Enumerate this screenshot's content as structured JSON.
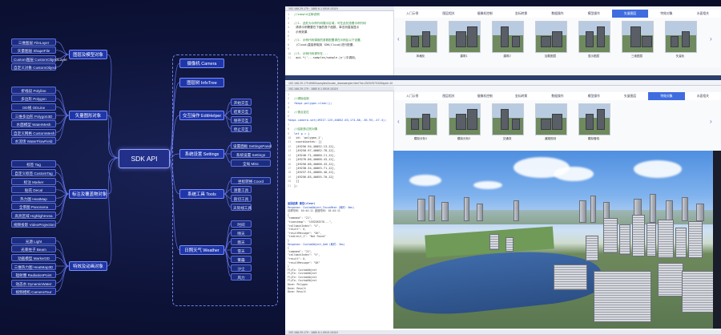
{
  "mindmap": {
    "root": "SDK API",
    "left_branches": [
      {
        "label": "图层及模型对象",
        "leaves": [
          "三维图层 FileLayer",
          "矢量图层 ShapeFile",
          "Custom图层 CustomObjectLayer",
          "自定义对象 CustomObject"
        ]
      },
      {
        "label": "矢量图形对象",
        "leaves": [
          "折线段 Polyline",
          "多边形 Polygon",
          "OD线 ODLine",
          "三维多边形 Polygon3D",
          "水面模型 WaterMesh",
          "自定义网格 CustomMesh",
          "水流场 WaterFlowField"
        ]
      },
      {
        "label": "标注及覆盖物对象",
        "leaves": [
          "标签 Tag",
          "自定义标签 CustomTag",
          "标注 Marker",
          "贴花 Decal",
          "热力图 HeatMap",
          "全景图 Panorama",
          "高亮区域 HighlightArea",
          "视频投影 VideoProjection"
        ]
      },
      {
        "label": "特效及动画对象",
        "leaves": [
          "光源 Light",
          "光束柱子 Beam",
          "动画模型 Marker3D",
          "三维热力图 HeatMap3D",
          "辐射圈 RadiationPoint",
          "动态水 DynamicWater",
          "视频相机 CameraTour"
        ]
      }
    ],
    "right_branches": [
      {
        "label": "摄像机 Camera",
        "leaves": []
      },
      {
        "label": "图层树 InfoTree",
        "leaves": []
      },
      {
        "label": "交互操作 EditHelper",
        "leaves": [
          "开始交互",
          "结束交互",
          "保存交互",
          "停止交互"
        ]
      },
      {
        "label": "系统设置 Settings",
        "leaves": [
          "设置面板 SettingsPanel",
          "系统设置 Settings",
          "全局 Misc"
        ]
      },
      {
        "label": "系统工具 Tools",
        "leaves": [
          "坐标转换 Coord",
          "测量工具",
          "剖切工具",
          "天际线工具"
        ]
      },
      {
        "label": "日照天气 Weather",
        "leaves": [
          "时间",
          "晴天",
          "雨天",
          "雪天",
          "雾霾",
          "沙尘",
          "风力"
        ]
      }
    ]
  },
  "screen": {
    "top_window_title": "192.168.29.179 : 1880    6.1.0919.10119",
    "mid_window_url": "192.168.29.179:8080/samples/locate_drawsample.html?id=25202570326&pid=10",
    "mid_window_title": "192.168.29.179 : 1880    6.1.0919.10119",
    "bottom_bar": "192.168.29.179 : 1880    6.1.0919.10119",
    "top_tabs": [
      "入门示例",
      "图层相关",
      "摄像机控制",
      "坐标转换",
      "数据操作",
      "模型操作",
      "矢量图层",
      "特效对象",
      "水面相关"
    ],
    "top_active_tab": 6,
    "top_thumbs": [
      "风格化",
      "建筑1",
      "建筑2",
      "加载图层",
      "显示图层",
      "三维图层",
      "矢量化"
    ],
    "mid_tabs": [
      "入门示例",
      "图层相关",
      "摄像机控制",
      "坐标转换",
      "数据操作",
      "模型操作",
      "矢量图层",
      "特效对象",
      "水面相关"
    ],
    "mid_active_tab": 7,
    "mid_thumbs": [
      "模拟分析1",
      "模拟分析2",
      "交通流",
      "道路规划",
      "模拟管线"
    ],
    "code_top": [
      "//sample注释说明",
      "",
      "//1. 此处为示例代码展示区域，可在此处查看示例代码",
      "     请求示例需要在下面的首个函数，单击则直接显示",
      "     示例效果",
      "",
      "//2. 示例代码调用的参数配置请在示例区以下设置，",
      "     (Cloud)直接获取到 SDK(Cloud)进行配置.",
      "",
      "//3. 示例代码请写在...",
      "    api.*('...samples/sample.js')中调用。"
    ],
    "code_mid": [
      "",
      "//清除绘制",
      "fdapi.polygon.clear();",
      "",
      "//视点定位",
      "fdapi.camera.set(49317.125,40052.03,174.86,-36.93,-47.4);",
      "",
      "//绘制多边形对象",
      "let p = {",
      "  id: 'polygon_1',",
      "  coordinates: [[",
      "    [49256.94,40052.13,12],",
      "    [49250.97,40062.78,12],",
      "    [49246.71,40060.11,12],",
      "    [49276.06,40068.43,12],",
      "    [49256.06,40068.43,12],",
      "    [49238.34,40063.71,12],",
      "    [49237.91,40066.40,12],",
      "    [49256.85,40055.70,12]",
      "  ]]",
      "};"
    ],
    "log_title": "返回结果 清空(clear)",
    "log_lines": [
      "Response: CustomObject_FocusMesh (耗时: 0ms)",
      "请求时间: 10:44:11   返回时间: 10:44:11",
      "{",
      "  \"command\": \"21\",",
      "  \"timestamp\": \"1592383376...\",",
      "  \"callbackIndex\": \"4\",",
      "  \"result\": 0,",
      "  \"resultMessage\": \"OK\",",
      "  \"redirect_1\": \"Not Found\"",
      "}",
      "",
      "Response: CustomObject_Add (耗时: 2ms)",
      "{",
      "  \"command\": \"22\",",
      "  \"callbackIndex\": \"5\",",
      "  \"result\": 0,",
      "  \"resultMessage\": \"OK\"",
      "}",
      "",
      "FlyTo: CustomObject",
      "FlyTo: CustomObject",
      "FlyTo: CustomObject",
      "FlyTo: CustomObject",
      "Done: Polygon",
      "Done: Result",
      "Done: Result"
    ]
  }
}
